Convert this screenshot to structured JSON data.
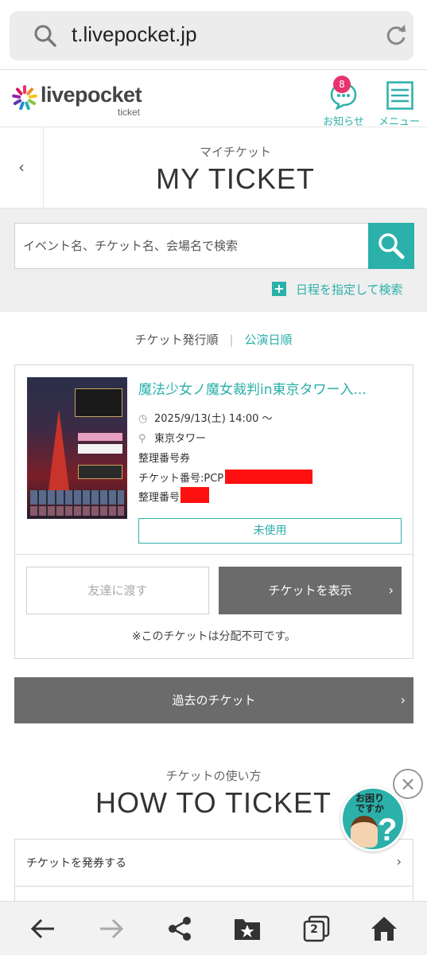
{
  "browser": {
    "url": "t.livepocket.jp"
  },
  "header": {
    "logo": "livepocket",
    "logo_sub": "ticket",
    "notice_badge": "8",
    "notice_label": "お知らせ",
    "menu_label": "メニュー"
  },
  "page": {
    "title_sub": "マイチケット",
    "title_main": "MY TICKET",
    "back_glyph": "‹"
  },
  "search": {
    "placeholder": "イベント名、チケット名、会場名で検索",
    "date_search_label": "日程を指定して検索"
  },
  "sort": {
    "option_a": "チケット発行順",
    "separator": "|",
    "option_b": "公演日順"
  },
  "ticket": {
    "event_title": "魔法少女ノ魔女裁判in東京タワー入...",
    "datetime": "2025/9/13(土) 14:00 〜",
    "venue": "東京タワー",
    "ticket_type": "整理番号券",
    "ticket_number_label": "チケット番号:PCP",
    "seat_number_label": "整理番号",
    "status": "未使用",
    "give_label": "友達に渡す",
    "show_label": "チケットを表示",
    "note": "※このチケットは分配不可です。"
  },
  "past_button": "過去のチケット",
  "how_to": {
    "sub": "チケットの使い方",
    "main": "HOW TO TICKET",
    "row1": "チケットを発券する"
  },
  "help": {
    "text_line1": "お困り",
    "text_line2": "ですか",
    "q": "?",
    "close": "×"
  },
  "bottom_bar": {
    "tab_count": "2"
  },
  "colors": {
    "accent": "#2bb0aa",
    "badge": "#e8336e",
    "button_dark": "#6b6b6b"
  }
}
